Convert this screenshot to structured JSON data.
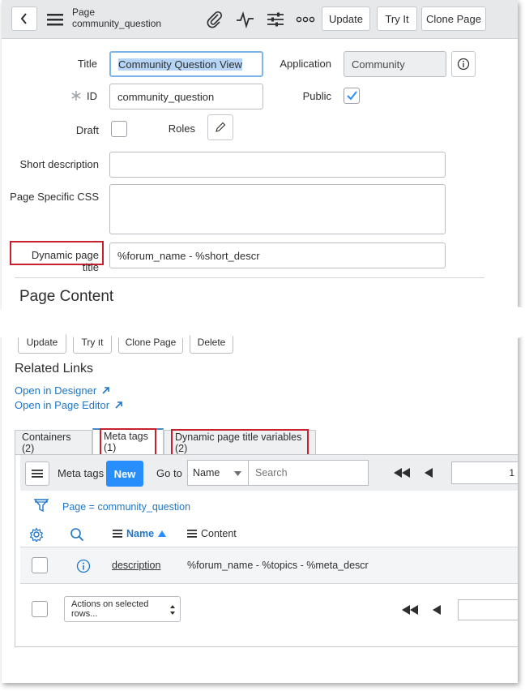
{
  "header": {
    "back_icon": "chevron-left-icon",
    "menu_icon": "hamburger-icon",
    "title_line1": "Page",
    "title_line2": "community_question",
    "update_label": "Update",
    "try_it_label": "Try It",
    "clone_page_label": "Clone Page"
  },
  "form": {
    "title_label": "Title",
    "title_value": "Community Question View",
    "application_label": "Application",
    "application_value": "Community",
    "id_label": "ID",
    "id_value": "community_question",
    "public_label": "Public",
    "public_checked": true,
    "draft_label": "Draft",
    "roles_label": "Roles",
    "short_description_label": "Short description",
    "short_description_value": "",
    "page_css_label": "Page Specific CSS",
    "dynamic_title_label": "Dynamic page title",
    "dynamic_title_value": "%forum_name - %short_descr",
    "page_content_heading": "Page Content"
  },
  "bottom_buttons": {
    "update_label": "Update",
    "try_it_label": "Try It",
    "clone_page_label": "Clone Page",
    "delete_label": "Delete"
  },
  "related_links": {
    "heading": "Related Links",
    "open_designer": "Open in Designer",
    "open_editor": "Open in Page Editor"
  },
  "tabs": [
    {
      "label": "Containers (2)"
    },
    {
      "label": "Meta tags (1)"
    },
    {
      "label": "Dynamic page title variables (2)"
    }
  ],
  "list": {
    "title": "Meta tags",
    "new_label": "New",
    "goto_label": "Go to",
    "goto_select": "Name",
    "search_placeholder": "Search",
    "page_field": "1",
    "filter_text": "Page = community_question",
    "col_name": "Name",
    "col_content": "Content",
    "rows": [
      {
        "name": "description",
        "content": "%forum_name - %topics - %meta_descr"
      }
    ],
    "actions_select": "Actions on selected rows..."
  },
  "colors": {
    "accent": "#278efc",
    "link": "#1f76c8",
    "highlight_box": "#c8202f",
    "title_selection": "#b6d4f5"
  }
}
